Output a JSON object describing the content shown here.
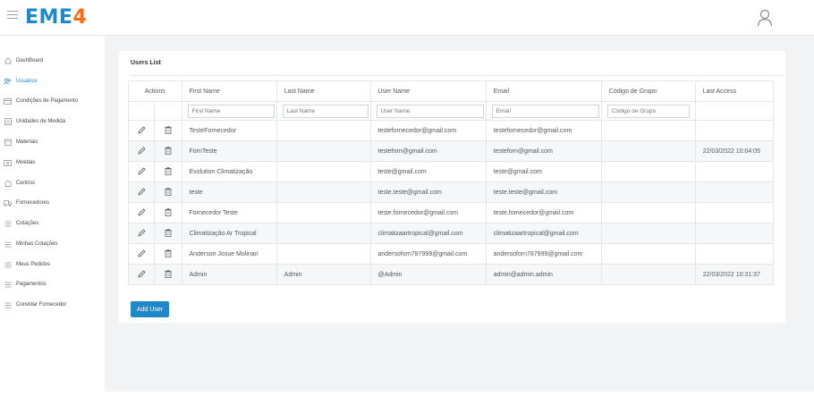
{
  "brand": {
    "logo_a": "EME",
    "logo_b": "4"
  },
  "sidebar": {
    "items": [
      {
        "label": "DashBoard",
        "icon": "home-icon",
        "active": false
      },
      {
        "label": "Usuários",
        "icon": "users-icon",
        "active": true
      },
      {
        "label": "Condições de Pagamento",
        "icon": "card-icon",
        "active": false
      },
      {
        "label": "Unidades de Medida",
        "icon": "ruler-icon",
        "active": false
      },
      {
        "label": "Materiais",
        "icon": "box-icon",
        "active": false
      },
      {
        "label": "Moedas",
        "icon": "money-icon",
        "active": false
      },
      {
        "label": "Centros",
        "icon": "building-icon",
        "active": false
      },
      {
        "label": "Fornecedores",
        "icon": "truck-icon",
        "active": false
      },
      {
        "label": "Cotações",
        "icon": "list-icon",
        "active": false
      },
      {
        "label": "Minhas Cotações",
        "icon": "list-icon",
        "active": false
      },
      {
        "label": "Meus Pedidos",
        "icon": "list-icon",
        "active": false
      },
      {
        "label": "Pagamentos",
        "icon": "list-icon",
        "active": false
      },
      {
        "label": "Convidar Fornecedor",
        "icon": "list-icon",
        "active": false
      }
    ]
  },
  "card": {
    "title": "Users List",
    "add_button": "Add User"
  },
  "table": {
    "headers": [
      "Actions",
      "First Name",
      "Last Name",
      "User Name",
      "Email",
      "Código de Grupo",
      "Last Access"
    ],
    "placeholders": {
      "first_name": "First Name",
      "last_name": "Last Name",
      "user_name": "User Name",
      "email": "Email",
      "group": "Código de Grupo"
    },
    "rows": [
      {
        "first": "TesteFornecedor",
        "last": "",
        "user": "testefornecedor@gmail.com",
        "email": "testefornecedor@gmail.com",
        "group": "",
        "access": ""
      },
      {
        "first": "FornTeste",
        "last": "",
        "user": "testeforn@gmail.com",
        "email": "testeforn@gmail.com",
        "group": "",
        "access": "22/03/2022 10:04:05"
      },
      {
        "first": "Evolution Climatização",
        "last": "",
        "user": "teste@gmail.com",
        "email": "teste@gmail.com",
        "group": "",
        "access": ""
      },
      {
        "first": "teste",
        "last": "",
        "user": "teste.teste@gmail.com",
        "email": "teste.teste@gmail.com",
        "group": "",
        "access": ""
      },
      {
        "first": "Fornecedor Teste",
        "last": "",
        "user": "teste.fornecedor@gmail.com",
        "email": "teste.fornecedor@gmail.com",
        "group": "",
        "access": ""
      },
      {
        "first": "Climatização Ar Tropical",
        "last": "",
        "user": "climatizaartropical@gmail.com",
        "email": "climatizaartropical@gmail.com",
        "group": "",
        "access": ""
      },
      {
        "first": "Anderson Josue Molinari",
        "last": "",
        "user": "andersoforn787999@gmail.com",
        "email": "andersoforn787999@gmail.com",
        "group": "",
        "access": ""
      },
      {
        "first": "Admin",
        "last": "Admin",
        "user": "@Admin",
        "email": "admin@admin.admin",
        "group": "",
        "access": "22/03/2022 10:31:37"
      }
    ]
  },
  "colors": {
    "accent": "#1e88c9",
    "brand_orange": "#ff6a13",
    "background": "#f2f3f5"
  }
}
